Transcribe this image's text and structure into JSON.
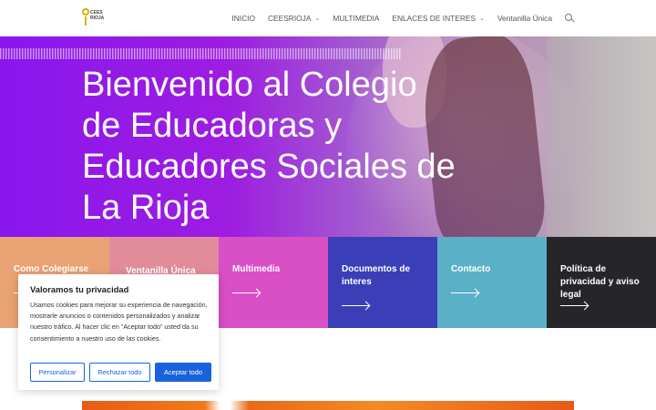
{
  "header": {
    "logo": {
      "line1": "CEES",
      "line2": "RIOJA"
    },
    "nav": [
      {
        "label": "INICIO",
        "has_dropdown": false
      },
      {
        "label": "CEESRIOJA",
        "has_dropdown": true
      },
      {
        "label": "MULTIMEDIA",
        "has_dropdown": false
      },
      {
        "label": "ENLACES DE INTERES",
        "has_dropdown": true
      },
      {
        "label": "Ventanilla Única",
        "has_dropdown": false
      }
    ],
    "search_icon": "search-icon"
  },
  "hero": {
    "title": "Bienvenido al Colegio de Educadoras y Educadores Sociales de La Rioja"
  },
  "tiles": [
    {
      "label": "Como Colegiarse",
      "color": "#e8a273"
    },
    {
      "label": "Ventanilla Única",
      "color": "#e28c99"
    },
    {
      "label": "Multimedia",
      "color": "#d94fc5"
    },
    {
      "label": "Documentos de interes",
      "color": "#3a3fb8"
    },
    {
      "label": "Contacto",
      "color": "#5ab0c7"
    },
    {
      "label": "Política de privacidad y aviso legal",
      "color": "#26262a"
    }
  ],
  "cookie": {
    "title": "Valoramos tu privacidad",
    "text": "Usamos cookies para mejorar su experiencia de navegación, mostrarle anuncios o contenidos personalizados y analizar nuestro tráfico. Al hacer clic en “Aceptar todo” usted da su consentimiento a nuestro uso de las cookies.",
    "buttons": {
      "customize": "Personalizar",
      "reject": "Rechazar todo",
      "accept": "Aceptar todo"
    },
    "accent": "#1863dc"
  }
}
